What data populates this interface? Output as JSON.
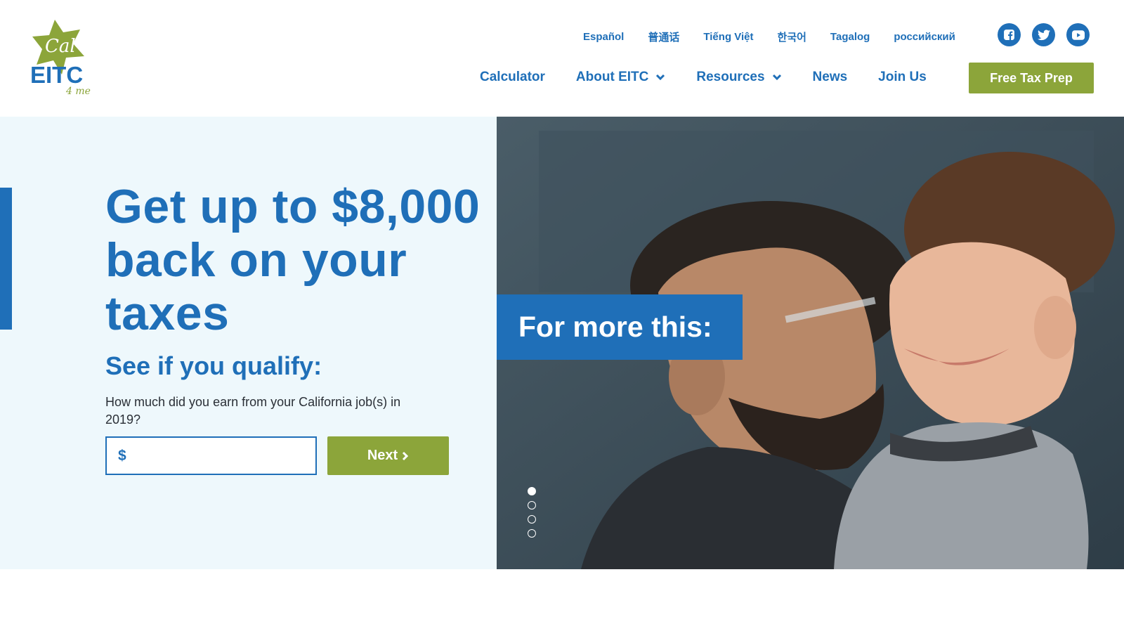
{
  "brand": {
    "logo_text_top": "Cal",
    "logo_text_main": "EITC",
    "logo_text_sub": "4 me",
    "primary_color": "#1f6fb8",
    "accent_color": "#8ca53a"
  },
  "languages": [
    "Español",
    "普通话",
    "Tiếng Việt",
    "한국어",
    "Tagalog",
    "российский"
  ],
  "social": [
    {
      "icon": "facebook-icon"
    },
    {
      "icon": "twitter-icon"
    },
    {
      "icon": "youtube-icon"
    }
  ],
  "nav": {
    "items": [
      {
        "label": "Calculator",
        "dropdown": false
      },
      {
        "label": "About EITC",
        "dropdown": true
      },
      {
        "label": "Resources",
        "dropdown": true
      },
      {
        "label": "News",
        "dropdown": false
      },
      {
        "label": "Join Us",
        "dropdown": false
      }
    ],
    "cta_label": "Free Tax Prep"
  },
  "hero": {
    "headline": "Get up to $8,000 back on your taxes",
    "subhead": "See if you qualify:",
    "question": "How much did you earn from your California job(s) in 2019?",
    "currency_symbol": "$",
    "amount_value": "",
    "next_label": "Next",
    "overlay_text": "For more this:",
    "slides_total": 4,
    "active_slide": 1
  }
}
